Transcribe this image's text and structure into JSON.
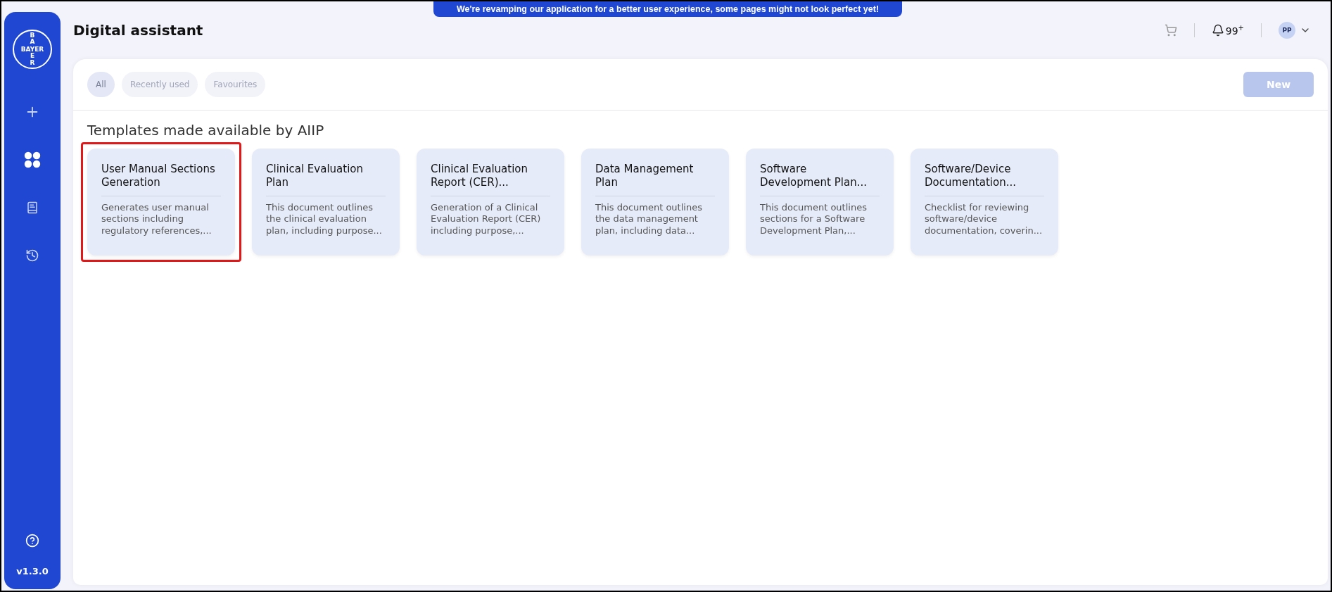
{
  "banner": "We're revamping our application for a better user experience, some pages might not look perfect yet!",
  "sidebar": {
    "logo": {
      "horizontal": "BAYER",
      "vertical_top": "BA",
      "vertical_bottom": "ER"
    },
    "items": [
      {
        "kind": "plus",
        "selected": false
      },
      {
        "kind": "grid",
        "selected": true
      },
      {
        "kind": "book",
        "selected": false
      },
      {
        "kind": "history",
        "selected": false
      }
    ],
    "version": "v1.3.0"
  },
  "header": {
    "title": "Digital assistant",
    "notifications": "99",
    "notifications_sup": "+",
    "avatar": "PP"
  },
  "filters": [
    {
      "label": "All",
      "selected": true
    },
    {
      "label": "Recently used",
      "selected": false
    },
    {
      "label": "Favourites",
      "selected": false
    }
  ],
  "new_button": {
    "label": "New",
    "disabled": true
  },
  "section_title": "Templates made available by AIIP",
  "templates": [
    {
      "title": "User Manual Sections Generation",
      "description": "Generates user manual sections including regulatory references,...",
      "highlighted": true
    },
    {
      "title": "Clinical Evaluation Plan",
      "description": "This document outlines the clinical evaluation plan, including purpose...",
      "highlighted": false
    },
    {
      "title": "Clinical Evaluation Report (CER)...",
      "description": "Generation of a Clinical Evaluation Report (CER) including purpose,...",
      "highlighted": false
    },
    {
      "title": "Data Management Plan",
      "description": "This document outlines the data management plan, including data...",
      "highlighted": false
    },
    {
      "title": "Software Development Plan...",
      "description": "This document outlines sections for a Software Development Plan,...",
      "highlighted": false
    },
    {
      "title": "Software/Device Documentation...",
      "description": "Checklist for reviewing software/device documentation, coverin...",
      "highlighted": false
    }
  ]
}
